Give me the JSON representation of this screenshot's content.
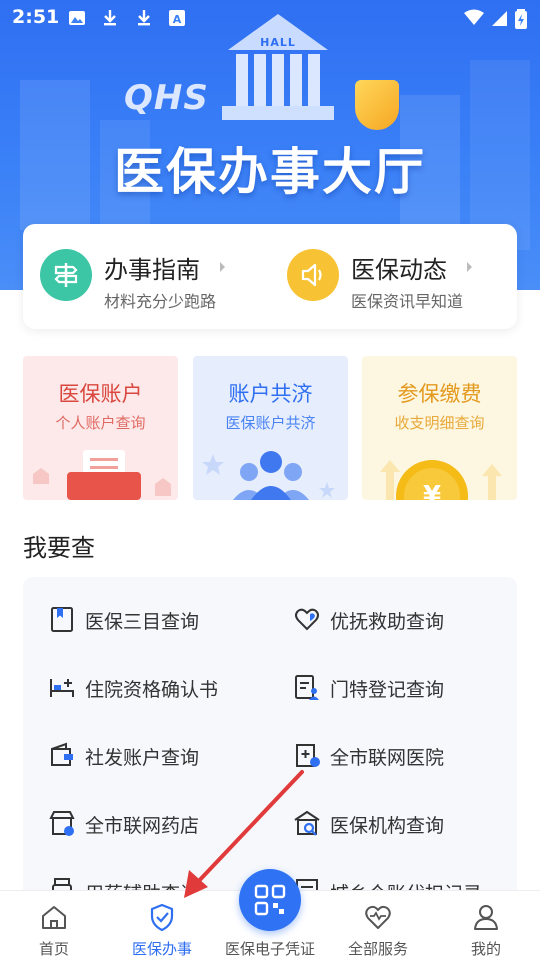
{
  "status_bar": {
    "time": "2:51"
  },
  "hero": {
    "title": "医保办事大厅",
    "hall_sign": "HALL",
    "brand": "QHS"
  },
  "guide": [
    {
      "title": "办事指南",
      "subtitle": "材料充分少跑路",
      "icon": "signpost-icon",
      "color": "#3cc6a6"
    },
    {
      "title": "医保动态",
      "subtitle": "医保资讯早知道",
      "icon": "speaker-icon",
      "color": "#f7c233"
    }
  ],
  "features": [
    {
      "title": "医保账户",
      "subtitle": "个人账户查询",
      "bg": "#fde9e9",
      "title_color": "#d9473f",
      "sub_color": "#e06a63"
    },
    {
      "title": "账户共济",
      "subtitle": "医保账户共济",
      "bg": "#e6edfd",
      "title_color": "#2f6ff2",
      "sub_color": "#4a84f4"
    },
    {
      "title": "参保缴费",
      "subtitle": "收支明细查询",
      "bg": "#fdf6e0",
      "title_color": "#e39a1f",
      "sub_color": "#e8a93a"
    }
  ],
  "section_title": "我要查",
  "queries": [
    {
      "label": "医保三目查询",
      "icon": "bookmark-doc-icon"
    },
    {
      "label": "优抚救助查询",
      "icon": "heart-hand-icon"
    },
    {
      "label": "住院资格确认书",
      "icon": "hospital-bed-icon"
    },
    {
      "label": "门特登记查询",
      "icon": "doc-person-icon"
    },
    {
      "label": "社发账户查询",
      "icon": "wallet-icon"
    },
    {
      "label": "全市联网医院",
      "icon": "hospital-network-icon"
    },
    {
      "label": "全市联网药店",
      "icon": "pharmacy-network-icon"
    },
    {
      "label": "医保机构查询",
      "icon": "building-search-icon"
    },
    {
      "label": "用药辅助查询",
      "icon": "pill-bottle-icon"
    },
    {
      "label": "城乡个账代扣记录",
      "icon": "record-icon"
    }
  ],
  "nav": [
    {
      "label": "首页",
      "icon": "home-icon"
    },
    {
      "label": "医保办事",
      "icon": "shield-check-icon",
      "active": true
    },
    {
      "label": "医保电子凭证",
      "icon": "qr-code-icon"
    },
    {
      "label": "全部服务",
      "icon": "heart-pulse-icon"
    },
    {
      "label": "我的",
      "icon": "person-icon"
    }
  ],
  "colors": {
    "primary": "#2f6ff2",
    "annotation_arrow": "#e03a3a"
  }
}
